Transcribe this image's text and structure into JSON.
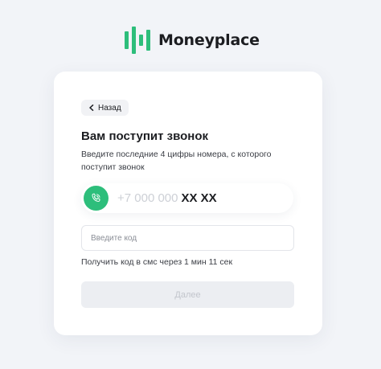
{
  "brand": {
    "name": "Moneyplace",
    "logo_icon": "bars-logo-icon",
    "accent_color": "#2dbe7b"
  },
  "card": {
    "back_label": "Назад",
    "title": "Вам поступит звонок",
    "description": "Введите последние 4 цифры номера, с которого поступит звонок",
    "phone": {
      "icon": "phone-call-icon",
      "prefix": "+7 000 000",
      "masked_digits": "XX XX"
    },
    "code_input": {
      "placeholder": "Введите код",
      "value": ""
    },
    "sms_note": "Получить код в смс через 1 мин 11 сек",
    "next_label": "Далее"
  }
}
